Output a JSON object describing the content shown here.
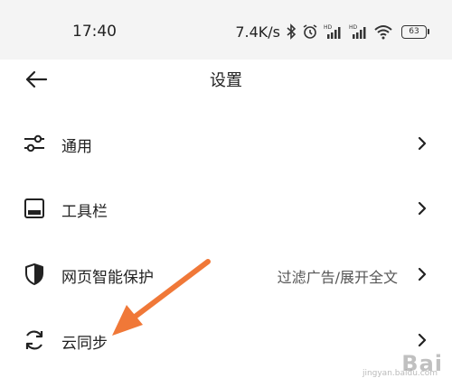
{
  "status_bar": {
    "time": "17:40",
    "network_speed": "7.4K/s",
    "battery_level": "63",
    "icons": [
      "bluetooth-icon",
      "alarm-icon",
      "signal-hd-icon",
      "signal-hd-icon",
      "wifi-icon",
      "battery-icon"
    ]
  },
  "header": {
    "title": "设置",
    "back_icon": "back-arrow-icon"
  },
  "settings": [
    {
      "icon": "sliders-icon",
      "label": "通用",
      "value": ""
    },
    {
      "icon": "toolbar-icon",
      "label": "工具栏",
      "value": ""
    },
    {
      "icon": "shield-icon",
      "label": "网页智能保护",
      "value": "过滤广告/展开全文"
    },
    {
      "icon": "sync-icon",
      "label": "云同步",
      "value": ""
    }
  ],
  "colors": {
    "annotation_arrow": "#f07838",
    "status_bar_bg": "#f4f4f4",
    "text": "#222222"
  },
  "watermark": {
    "text": "Bai",
    "sub": "jingyan.baidu.com"
  }
}
